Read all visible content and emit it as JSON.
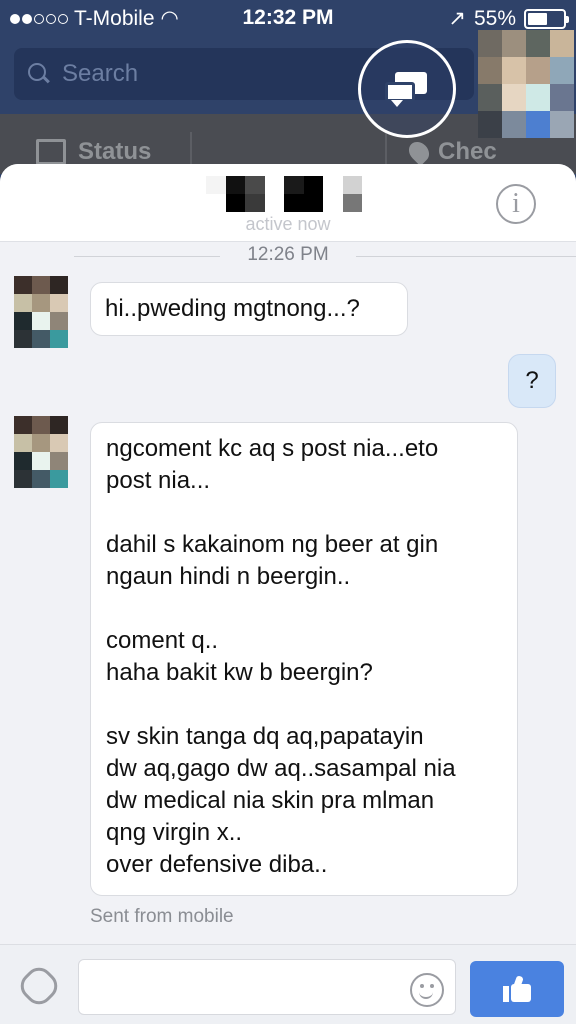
{
  "status_bar": {
    "carrier": "T-Mobile",
    "time": "12:32 PM",
    "battery": "55%",
    "battery_level": 0.55,
    "signal_filled": 2,
    "signal_total": 5
  },
  "fb_header": {
    "search_placeholder": "Search",
    "status_label": "Status",
    "checkin_label": "Chec"
  },
  "conversation": {
    "subtitle": "active now",
    "timestamp": "12:26 PM",
    "messages": [
      {
        "direction": "in",
        "lines": [
          "hi..pweding mgtnong...?"
        ]
      },
      {
        "direction": "out",
        "lines": [
          "?"
        ]
      },
      {
        "direction": "in",
        "lines": [
          "ngcoment kc aq s post nia...eto",
          "post nia...",
          "",
          "dahil s kakainom ng beer at gin",
          "ngaun hindi n beergin..",
          "",
          "coment q..",
          "haha bakit kw b beergin?",
          "",
          "sv skin tanga dq aq,papatayin",
          "dw aq,gago dw aq..sasampal nia",
          "dw medical nia skin pra mlman",
          "qng virgin x..",
          "over defensive diba.."
        ]
      }
    ],
    "sent_from": "Sent from mobile"
  },
  "colors": {
    "fb_blue": "#2f4269",
    "like_blue": "#4a82e0",
    "outgoing_bubble": "#d9e8f8"
  },
  "icons": {
    "chat_heads": "chat-heads-icon",
    "info": "info-icon",
    "attach": "paperclip-icon",
    "emoji": "smiley-icon",
    "like": "thumbs-up-icon"
  },
  "pixelation": {
    "avatar_top": [
      "#6f6a62",
      "#9c8f7e",
      "#5e6660",
      "#c9b59a",
      "#877a6a",
      "#d7c2a8",
      "#b6a08a",
      "#8fa7b8",
      "#5a5f5d",
      "#e6d6c2",
      "#cfe9e6",
      "#6a7690",
      "#3b4048",
      "#7c8a9c",
      "#4d7fd0",
      "#9aa6b4"
    ],
    "name_blur": [
      "#f4f4f4",
      "#111",
      "#4a4a4a",
      "#fff",
      "#1a1a1a",
      "#000",
      "#fff",
      "#d2d2d2",
      "#fff",
      "#000",
      "#3a3a3a",
      "#fff",
      "#000",
      "#000",
      "#fff",
      "#777"
    ],
    "msg_avatar": [
      "#3c2f2a",
      "#6d5a4e",
      "#2e2623",
      "#c7c0a6",
      "#a6977f",
      "#d9c9b4",
      "#1f2a2e",
      "#e9f3ee",
      "#8f8578",
      "#2c3236",
      "#445a66",
      "#3a9a9e"
    ]
  }
}
